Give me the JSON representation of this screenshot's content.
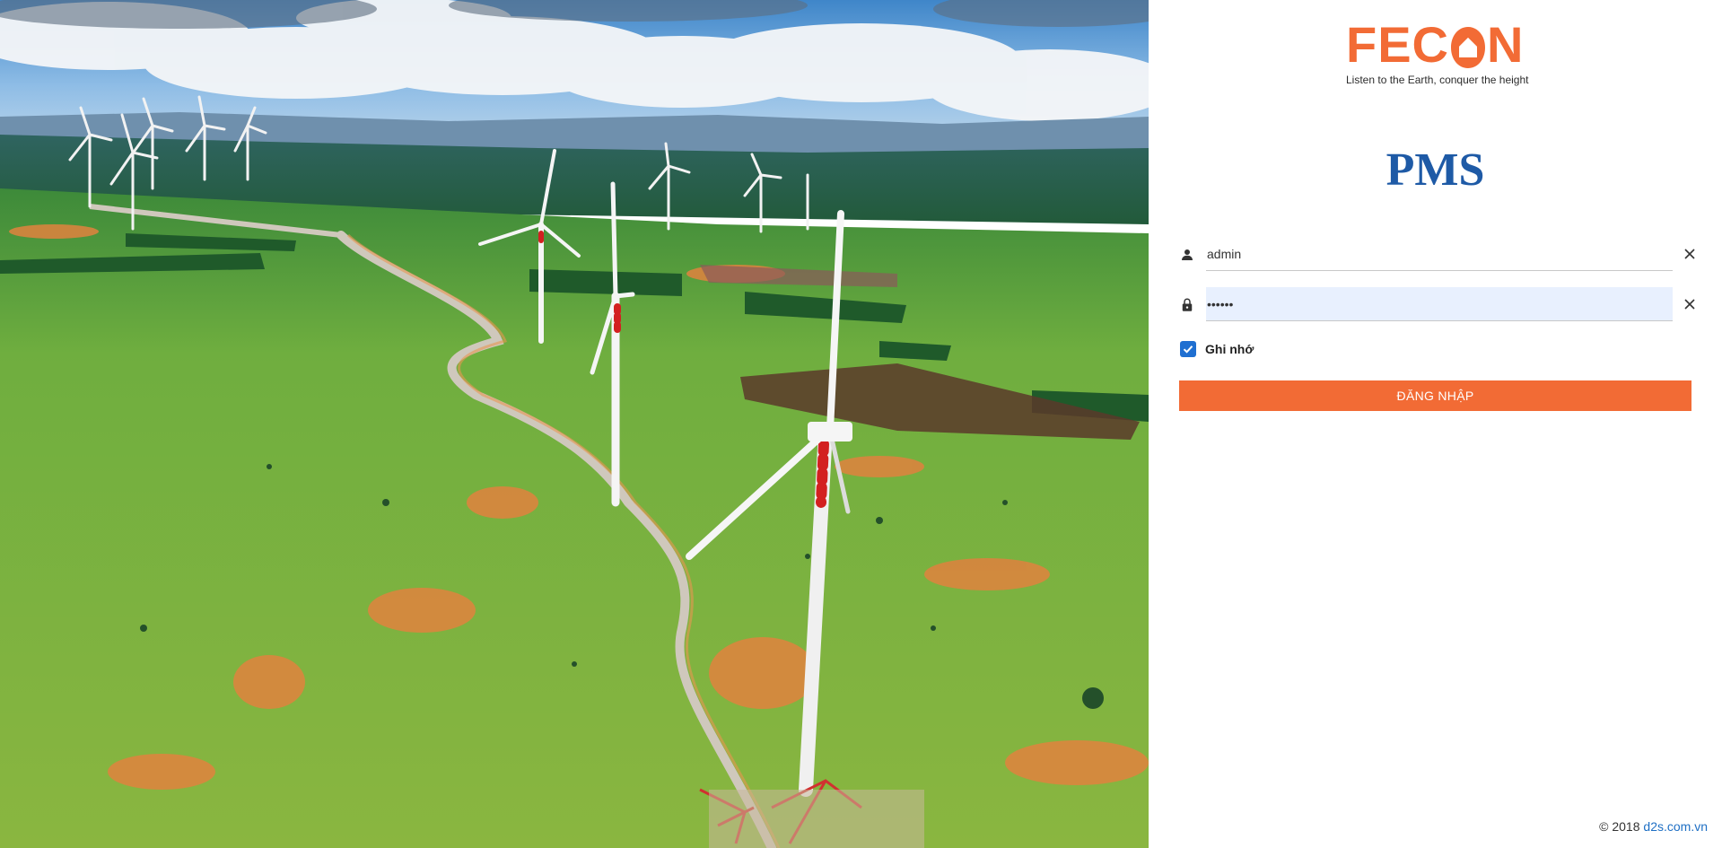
{
  "brand": {
    "logo_text_left": "FEC",
    "logo_text_right": "N",
    "tagline": "Listen to the Earth, conquer the height",
    "brand_color": "#f26b35"
  },
  "app": {
    "title": "PMS",
    "title_color": "#1e5aa6"
  },
  "login_form": {
    "username": {
      "icon": "user-icon",
      "value": "admin",
      "clear_icon": "close-icon"
    },
    "password": {
      "icon": "lock-icon",
      "value": "••••••",
      "clear_icon": "close-icon"
    },
    "remember": {
      "label": "Ghi nhớ",
      "checked": true
    },
    "submit_label": "ĐĂNG NHẬP"
  },
  "footer": {
    "copyright": "© 2018 ",
    "link_text": "d2s.com.vn"
  }
}
